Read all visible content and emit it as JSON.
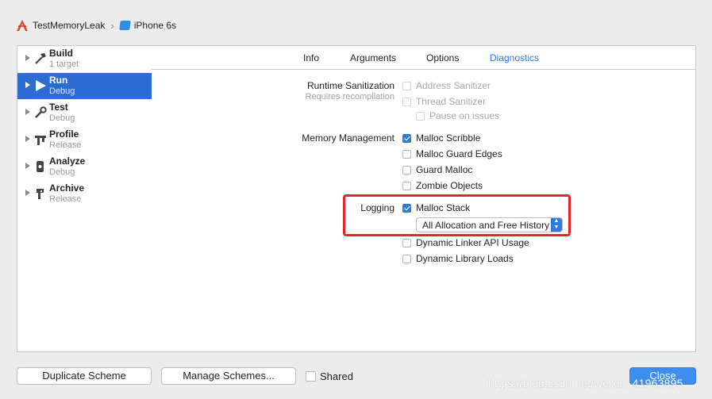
{
  "breadcrumb": {
    "project": "TestMemoryLeak",
    "device": "iPhone 6s"
  },
  "sidebar": {
    "items": [
      {
        "name": "Build",
        "sub": "1 target",
        "selected": false,
        "icon": "hammer-icon"
      },
      {
        "name": "Run",
        "sub": "Debug",
        "selected": true,
        "icon": "play-icon"
      },
      {
        "name": "Test",
        "sub": "Debug",
        "selected": false,
        "icon": "wrench-icon"
      },
      {
        "name": "Profile",
        "sub": "Release",
        "selected": false,
        "icon": "instruments-icon"
      },
      {
        "name": "Analyze",
        "sub": "Debug",
        "selected": false,
        "icon": "analyze-icon"
      },
      {
        "name": "Archive",
        "sub": "Release",
        "selected": false,
        "icon": "archive-icon"
      }
    ]
  },
  "tabs": [
    "Info",
    "Arguments",
    "Options",
    "Diagnostics"
  ],
  "active_tab": "Diagnostics",
  "diagnostics": {
    "runtime_label": "Runtime Sanitization",
    "runtime_sub": "Requires recompilation",
    "address_sanitizer": "Address Sanitizer",
    "thread_sanitizer": "Thread Sanitizer",
    "pause_on_issues": "Pause on issues",
    "memory_label": "Memory Management",
    "malloc_scribble": "Malloc Scribble",
    "malloc_guard_edges": "Malloc Guard Edges",
    "guard_malloc": "Guard Malloc",
    "zombie_objects": "Zombie Objects",
    "logging_label": "Logging",
    "malloc_stack": "Malloc Stack",
    "malloc_stack_option": "All Allocation and Free History",
    "dyld_api_usage": "Dynamic Linker API Usage",
    "dyld_library_loads": "Dynamic Library Loads"
  },
  "footer": {
    "duplicate": "Duplicate Scheme",
    "manage": "Manage Schemes...",
    "shared": "Shared",
    "close": "Close"
  },
  "watermark": "https://blog.csdn.net/weixin_41963895",
  "colors": {
    "accent": "#2d7be0",
    "selection": "#2d6dd2",
    "highlight_box": "#e8262a"
  }
}
